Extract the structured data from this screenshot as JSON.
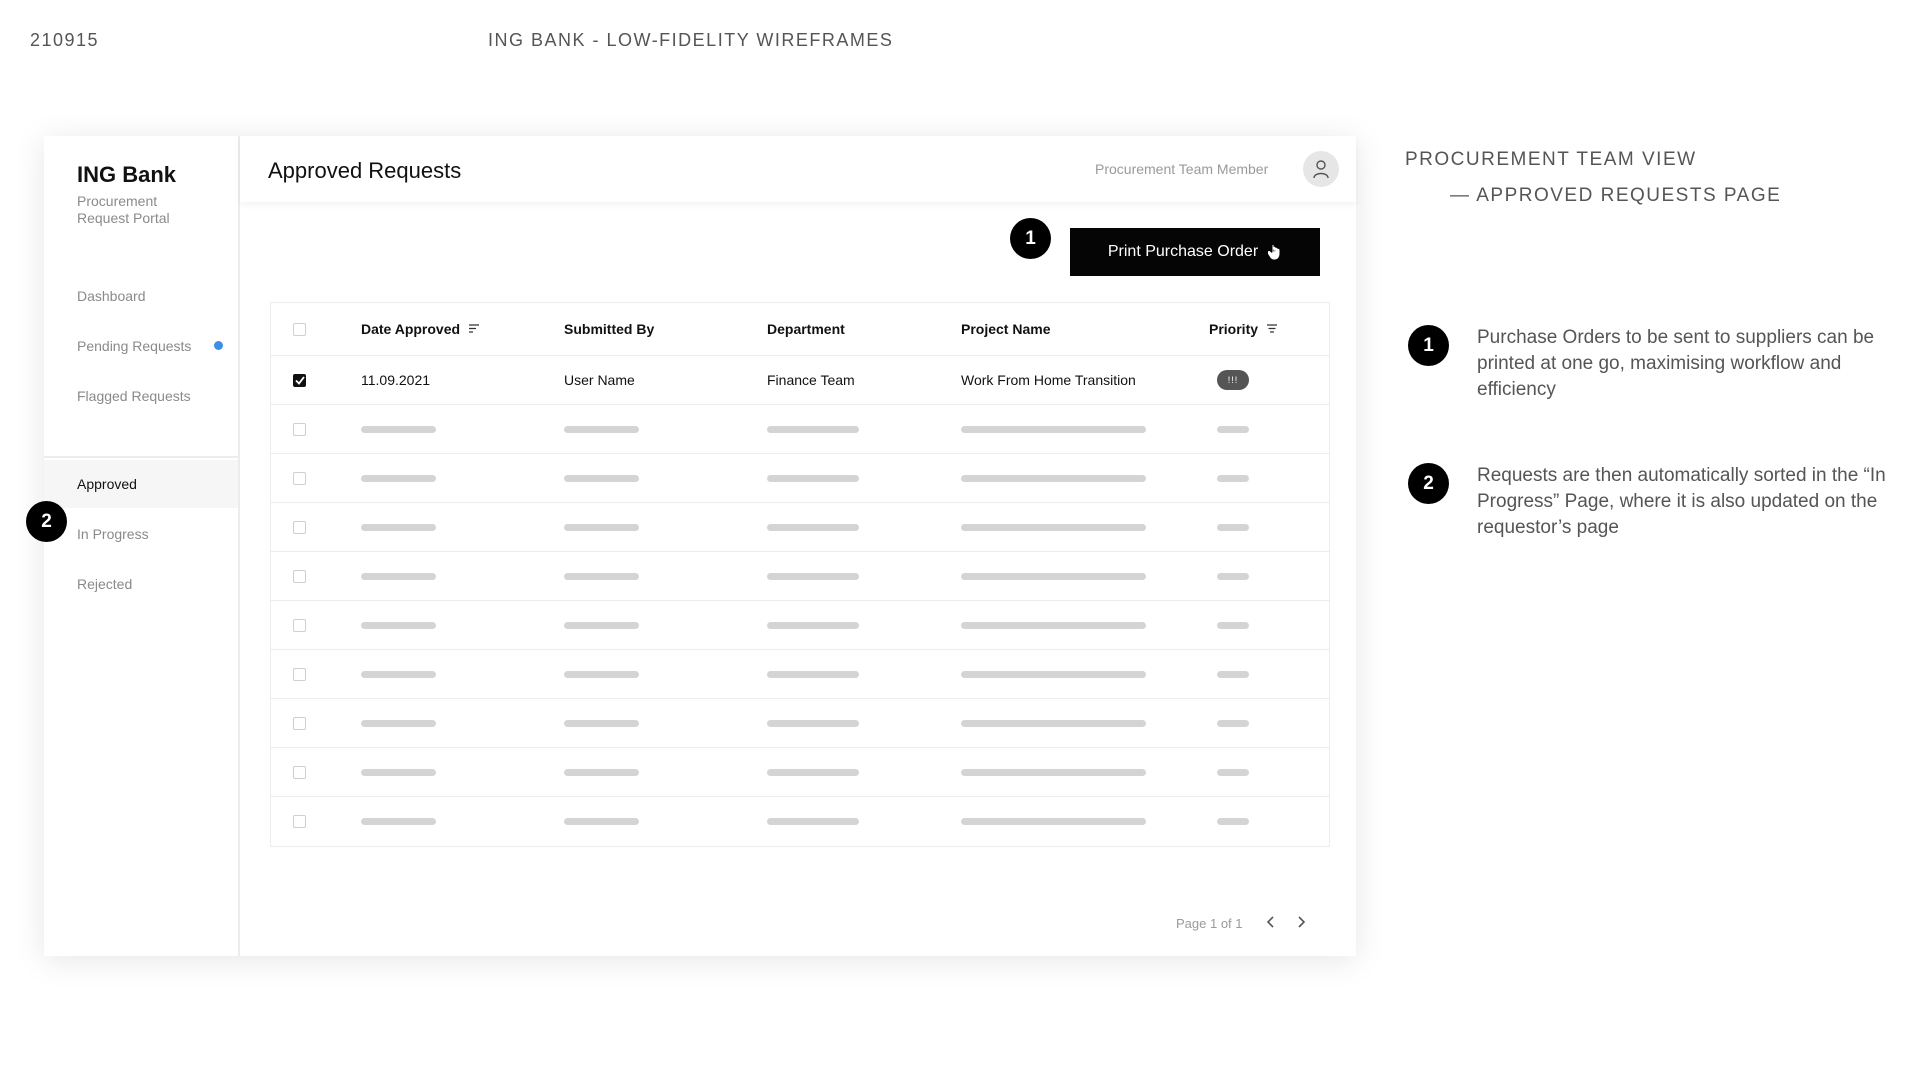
{
  "doc": {
    "id": "210915",
    "title": "ING BANK - LOW-FIDELITY WIREFRAMES"
  },
  "sidebar": {
    "brand": "ING Bank",
    "subtitle": "Procurement Request Portal",
    "items": [
      {
        "label": "Dashboard"
      },
      {
        "label": "Pending Requests",
        "has_dot": true
      },
      {
        "label": "Flagged Requests"
      },
      {
        "label": "Approved",
        "active": true
      },
      {
        "label": "In Progress"
      },
      {
        "label": "Rejected"
      }
    ]
  },
  "header": {
    "title": "Approved Requests",
    "user_role": "Procurement Team Member",
    "avatar_icon": "user-icon"
  },
  "toolbar": {
    "print_label": "Print Purchase Order",
    "badge": "1"
  },
  "table": {
    "columns": [
      "Date Approved",
      "Submitted By",
      "Department",
      "Project Name",
      "Priority"
    ],
    "rows": [
      {
        "checked": true,
        "date": "11.09.2021",
        "submitted_by": "User Name",
        "department": "Finance Team",
        "project": "Work From Home Transition",
        "priority": "!!!"
      }
    ],
    "placeholder_rows": 9
  },
  "pager": {
    "text": "Page 1 of 1"
  },
  "annotations": {
    "view_title_line1": "PROCUREMENT TEAM VIEW",
    "view_title_line2": "— APPROVED REQUESTS PAGE",
    "sidebar_badge": "2",
    "notes": [
      {
        "num": "1",
        "text": "Purchase Orders to be sent to suppliers can be printed at one go, maximising workflow and efficiency"
      },
      {
        "num": "2",
        "text": "Requests are then automatically sorted in the “In Progress” Page, where it is also updated on the requestor’s page"
      }
    ]
  },
  "colors": {
    "accent_dot": "#3b8fe6",
    "button_bg": "#050505",
    "badge_bg": "#000000"
  }
}
